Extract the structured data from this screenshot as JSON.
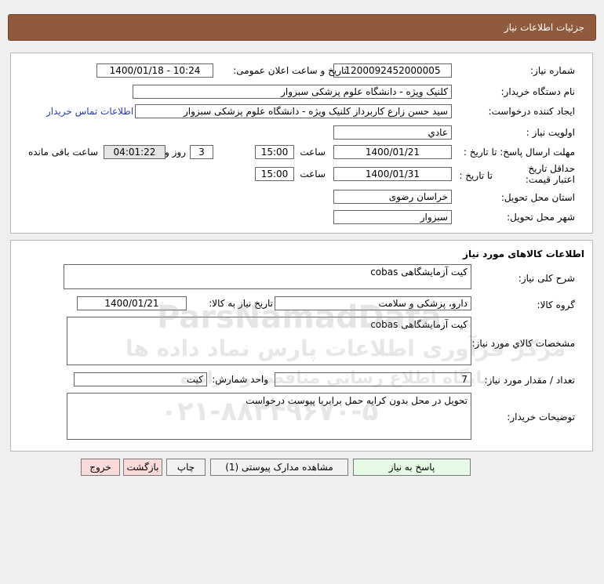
{
  "header": {
    "title": "جزئیات اطلاعات نیاز"
  },
  "info": {
    "need_number_label": "شماره نیاز:",
    "need_number": "1200092452000005",
    "announce_label": "تاریخ و ساعت اعلان عمومی:",
    "announce_value": "1400/01/18 - 10:24",
    "buyer_org_label": "نام دستگاه خریدار:",
    "buyer_org": "کلنیک ویژه - دانشگاه علوم پزشکی سبزوار",
    "requester_label": "ایجاد کننده درخواست:",
    "requester": "سید حسن زارع کاربرداز کلنیک ویژه - دانشگاه علوم پزشکی سبزوار",
    "contact_link": "اطلاعات تماس خریدار",
    "priority_label": "اولویت نیاز :",
    "priority": "عادي",
    "deadline_label": "مهلت ارسال پاسخ: تا تاریخ :",
    "deadline_date": "1400/01/21",
    "time_label": "ساعت",
    "deadline_time": "15:00",
    "days": "3",
    "days_label": "روز و",
    "remaining": "04:01:22",
    "remaining_label": "ساعت باقی مانده",
    "validity_label": "حداقل تاریخ اعتبار قیمت:",
    "validity_to_label": "تا تاریخ :",
    "validity_date": "1400/01/31",
    "validity_time_label": "ساعت",
    "validity_time": "15:00",
    "province_label": "استان محل تحویل:",
    "province": "خراسان رضوی",
    "city_label": "شهر محل تحویل:",
    "city": "سبزوار"
  },
  "goods": {
    "section_title": "اطلاعات کالاهای مورد نیاز",
    "general_desc_label": "شرح کلی نیاز:",
    "general_desc": "کیت آزمایشگاهی cobas",
    "group_label": "گروه کالا:",
    "group": "دارو، پزشکی و سلامت",
    "need_date_label": "تاریخ نیاز به کالا:",
    "need_date": "1400/01/21",
    "spec_label": "مشخصات کالاي مورد نیاز:",
    "spec": "کیت آزمایشگاهی cobas",
    "qty_label": "تعداد / مقدار مورد نیاز:",
    "qty": "7",
    "unit_label": "واحد شمارش:",
    "unit": "کیت",
    "buyer_notes_label": "توضیحات خریدار:",
    "buyer_notes": "تحویل در محل بدون کرایه حمل برابربا پیوست درخواست"
  },
  "buttons": {
    "reply": "پاسخ به نیاز",
    "attachments": "مشاهده مدارک پیوستی (1)",
    "print": "چاپ",
    "back": "بازگشت",
    "exit": "خروج"
  },
  "watermark": {
    "brand": "ParsNamadData",
    "line1": "مرکز فرآوری اطلاعات پارس نماد داده ها",
    "line2": "پایگاه اطلاع رسانی مناقصه و مزایده",
    "phone": "۰۲۱-۸۸۳۴۹۶۷۰-۵"
  }
}
